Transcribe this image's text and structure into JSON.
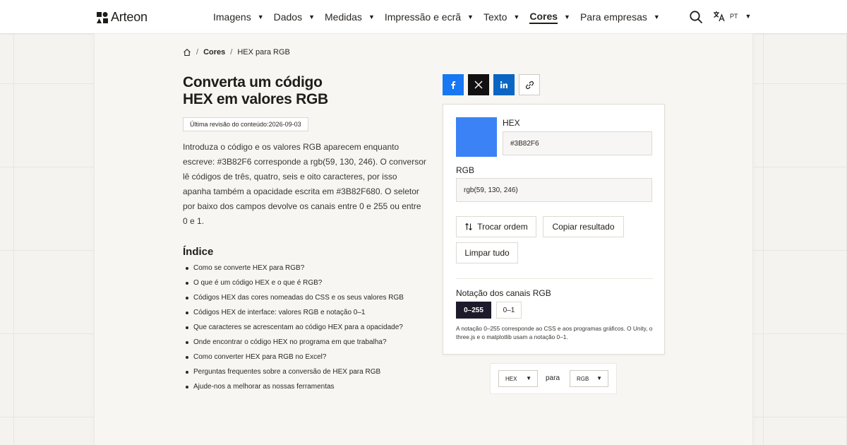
{
  "header": {
    "logo_text": "Arteon",
    "nav": [
      {
        "label": "Imagens"
      },
      {
        "label": "Dados"
      },
      {
        "label": "Medidas"
      },
      {
        "label": "Impressão e ecrã"
      },
      {
        "label": "Texto"
      },
      {
        "label": "Cores",
        "active": true
      },
      {
        "label": "Para empresas"
      }
    ],
    "language": "PT"
  },
  "breadcrumb": {
    "items": [
      "Cores",
      "HEX para RGB"
    ],
    "separator": "/"
  },
  "page": {
    "title_line1": "Converta um código",
    "title_line2": "HEX em valores RGB",
    "revision_label": "Última revisão do conteúdo:",
    "revision_date": "2026-09-03",
    "intro": "Introduza o código e os valores RGB aparecem enquanto escreve: #3B82F6 corresponde a rgb(59, 130, 246). O conversor lê códigos de três, quatro, seis e oito caracteres, por isso apanha também a opacidade escrita em #3B82F680. O seletor por baixo dos campos devolve os canais entre 0 e 255 ou entre 0 e 1."
  },
  "toc": {
    "title": "Índice",
    "items": [
      "Como se converte HEX para RGB?",
      "O que é um código HEX e o que é RGB?",
      "Códigos HEX das cores nomeadas do CSS e os seus valores RGB",
      "Códigos HEX de interface: valores RGB e notação 0–1",
      "Que caracteres se acrescentam ao código HEX para a opacidade?",
      "Onde encontrar o código HEX no programa em que trabalha?",
      "Como converter HEX para RGB no Excel?",
      "Perguntas frequentes sobre a conversão de HEX para RGB",
      "Ajude-nos a melhorar as nossas ferramentas"
    ]
  },
  "converter": {
    "swatch_color": "#3B82F6",
    "hex_label": "HEX",
    "hex_value": "#3B82F6",
    "rgb_label": "RGB",
    "rgb_value": "rgb(59, 130, 246)",
    "swap_label": "Trocar ordem",
    "copy_label": "Copiar resultado",
    "clear_label": "Limpar tudo",
    "notation_label": "Notação dos canais RGB",
    "notation_options": [
      "0–255",
      "0–1"
    ],
    "notation_selected": "0–255",
    "note": "A notação 0–255 corresponde ao CSS e aos programas gráficos. O Unity, o three.js e o matplotlib usam a notação 0–1."
  },
  "direction": {
    "from": "HEX",
    "connector": "para",
    "to": "RGB"
  },
  "colors": {
    "facebook": "#1877f2",
    "x": "#111111",
    "linkedin": "#0a66c2",
    "selected_segment": "#1c1a2b"
  }
}
